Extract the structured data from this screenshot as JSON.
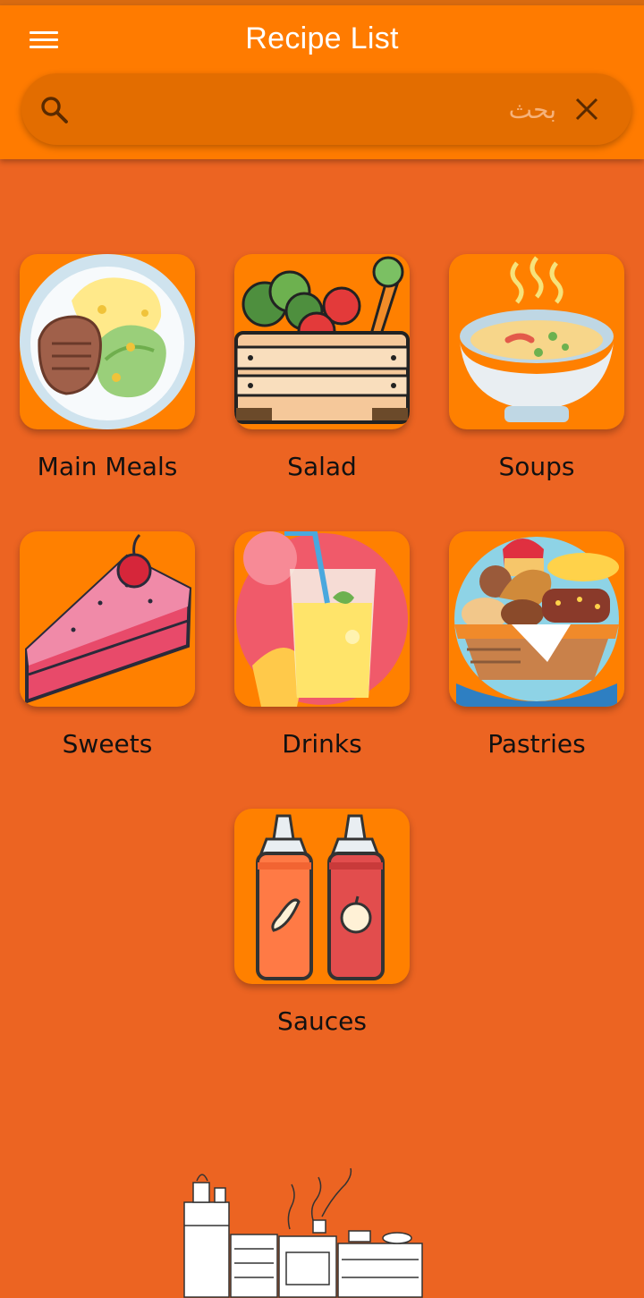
{
  "app": {
    "title": "Recipe List"
  },
  "search": {
    "placeholder": "بحث",
    "value": ""
  },
  "icons": {
    "menu": "menu-icon",
    "search": "search-icon",
    "clear": "close-icon"
  },
  "colors": {
    "appbar": "#FF7B00",
    "background": "#EC6422",
    "tile": "#FF8000"
  },
  "categories": [
    {
      "label": "Main Meals",
      "icon": "main-meals-icon"
    },
    {
      "label": "Salad",
      "icon": "salad-icon"
    },
    {
      "label": "Soups",
      "icon": "soup-icon"
    },
    {
      "label": "Sweets",
      "icon": "cake-icon"
    },
    {
      "label": "Drinks",
      "icon": "drink-icon"
    },
    {
      "label": "Pastries",
      "icon": "pastries-icon"
    },
    {
      "label": "Sauces",
      "icon": "sauces-icon"
    }
  ]
}
